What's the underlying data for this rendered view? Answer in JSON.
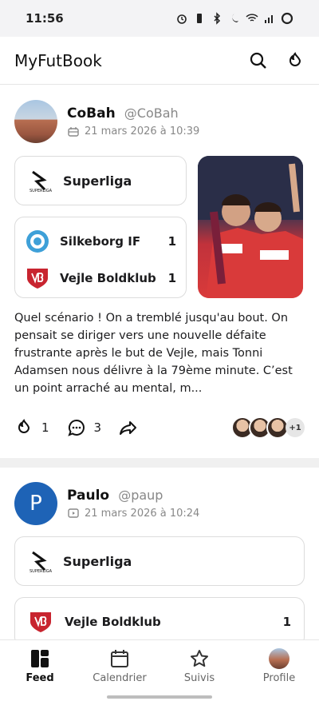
{
  "status_bar": {
    "time": "11:56"
  },
  "app": {
    "title": "MyFutBook"
  },
  "posts": [
    {
      "author": "CoBah",
      "handle": "@CoBah",
      "timestamp": "21 mars 2026 à 10:39",
      "league": "Superliga",
      "teams": [
        {
          "name": "Silkeborg IF",
          "score": "1"
        },
        {
          "name": "Vejle Boldklub",
          "score": "1"
        }
      ],
      "text": "Quel scénario ! On a tremblé jusqu'au bout. On pensait se diriger vers une nouvelle défaite frustrante après le but de Vejle, mais Tonni Adamsen nous délivre à la 79ème minute. C’est un point arraché au mental, m...",
      "likes": "1",
      "comments": "3",
      "more_reactors": "+1"
    },
    {
      "author": "Paulo",
      "avatar_letter": "P",
      "handle": "@paup",
      "timestamp": "21 mars 2026 à 10:24",
      "league": "Superliga",
      "teams": [
        {
          "name": "Vejle Boldklub",
          "score": "1"
        }
      ]
    }
  ],
  "bottom_nav": [
    {
      "label": "Feed",
      "icon": "feed-icon"
    },
    {
      "label": "Calendrier",
      "icon": "calendar-icon"
    },
    {
      "label": "Suivis",
      "icon": "star-icon"
    },
    {
      "label": "Profile",
      "icon": "avatar"
    }
  ],
  "colors": {
    "accent": "#1e63b6",
    "text": "#1c1c1e",
    "muted": "#888888"
  }
}
